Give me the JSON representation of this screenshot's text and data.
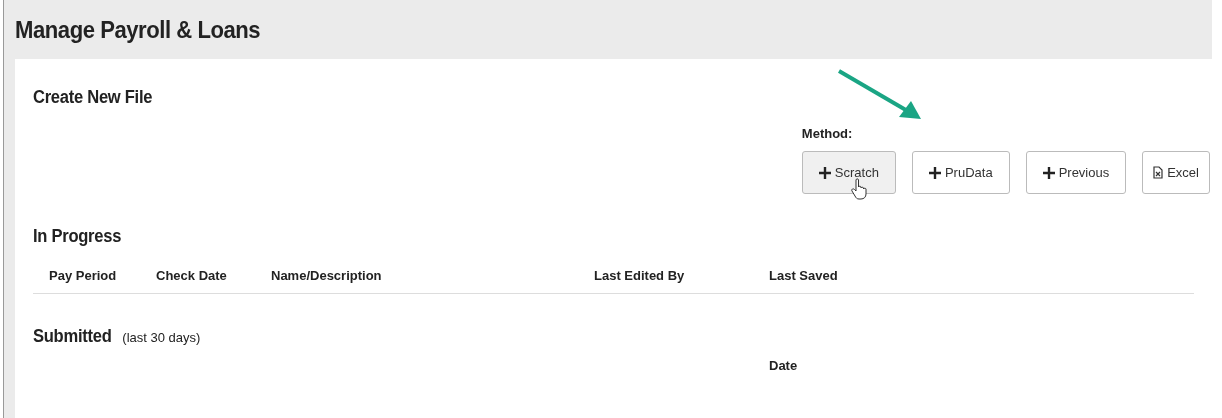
{
  "page_title": "Manage Payroll & Loans",
  "create": {
    "title": "Create New File",
    "method_label": "Method:",
    "buttons": [
      {
        "label": "Scratch",
        "kind": "plus",
        "hovered": true
      },
      {
        "label": "PruData",
        "kind": "plus",
        "hovered": false
      },
      {
        "label": "Previous",
        "kind": "plus",
        "hovered": false
      },
      {
        "label": "Excel",
        "kind": "file",
        "hovered": false
      }
    ]
  },
  "in_progress": {
    "title": "In Progress",
    "columns": [
      "Pay Period",
      "Check Date",
      "Name/Description",
      "Last Edited By",
      "Last Saved"
    ]
  },
  "submitted": {
    "title": "Submitted",
    "note": "(last 30 days)",
    "columns": [
      null,
      null,
      null,
      null,
      "Date"
    ]
  }
}
